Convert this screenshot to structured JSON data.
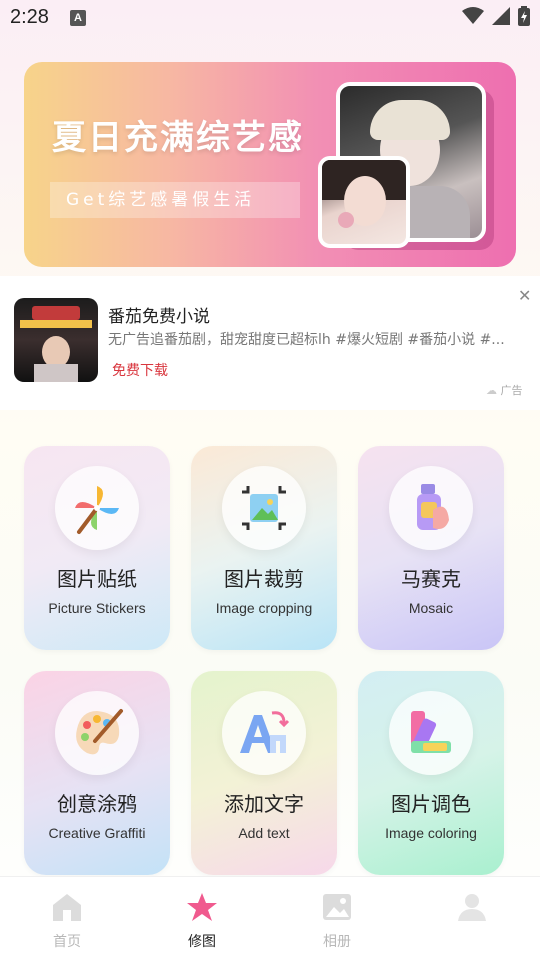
{
  "status_bar": {
    "time": "2:28",
    "notification_letter": "A"
  },
  "banner": {
    "title": "夏日充满综艺感",
    "subtitle": "Get综艺感暑假生活"
  },
  "ad": {
    "title": "番茄免费小说",
    "description": "无广告追番茄剧，甜宠甜度已超标lh #爆火短剧 #番茄小说 #...",
    "cta": "免费下载",
    "close": "✕",
    "label": "广告"
  },
  "tools": [
    {
      "cn": "图片贴纸",
      "en": "Picture Stickers",
      "icon": "pinwheel-icon"
    },
    {
      "cn": "图片裁剪",
      "en": "Image cropping",
      "icon": "crop-icon"
    },
    {
      "cn": "马赛克",
      "en": "Mosaic",
      "icon": "spray-can-icon"
    },
    {
      "cn": "创意涂鸦",
      "en": "Creative Graffiti",
      "icon": "palette-icon"
    },
    {
      "cn": "添加文字",
      "en": "Add text",
      "icon": "text-icon"
    },
    {
      "cn": "图片调色",
      "en": "Image coloring",
      "icon": "color-swatch-icon"
    }
  ],
  "nav": {
    "items": [
      {
        "label": "首页",
        "icon": "home-icon"
      },
      {
        "label": "修图",
        "icon": "star-icon",
        "active": true
      },
      {
        "label": "相册",
        "icon": "album-icon"
      },
      {
        "label": "",
        "icon": "profile-icon"
      }
    ]
  },
  "colors": {
    "accent": "#f05a8e",
    "ad_cta": "#d9363e"
  }
}
